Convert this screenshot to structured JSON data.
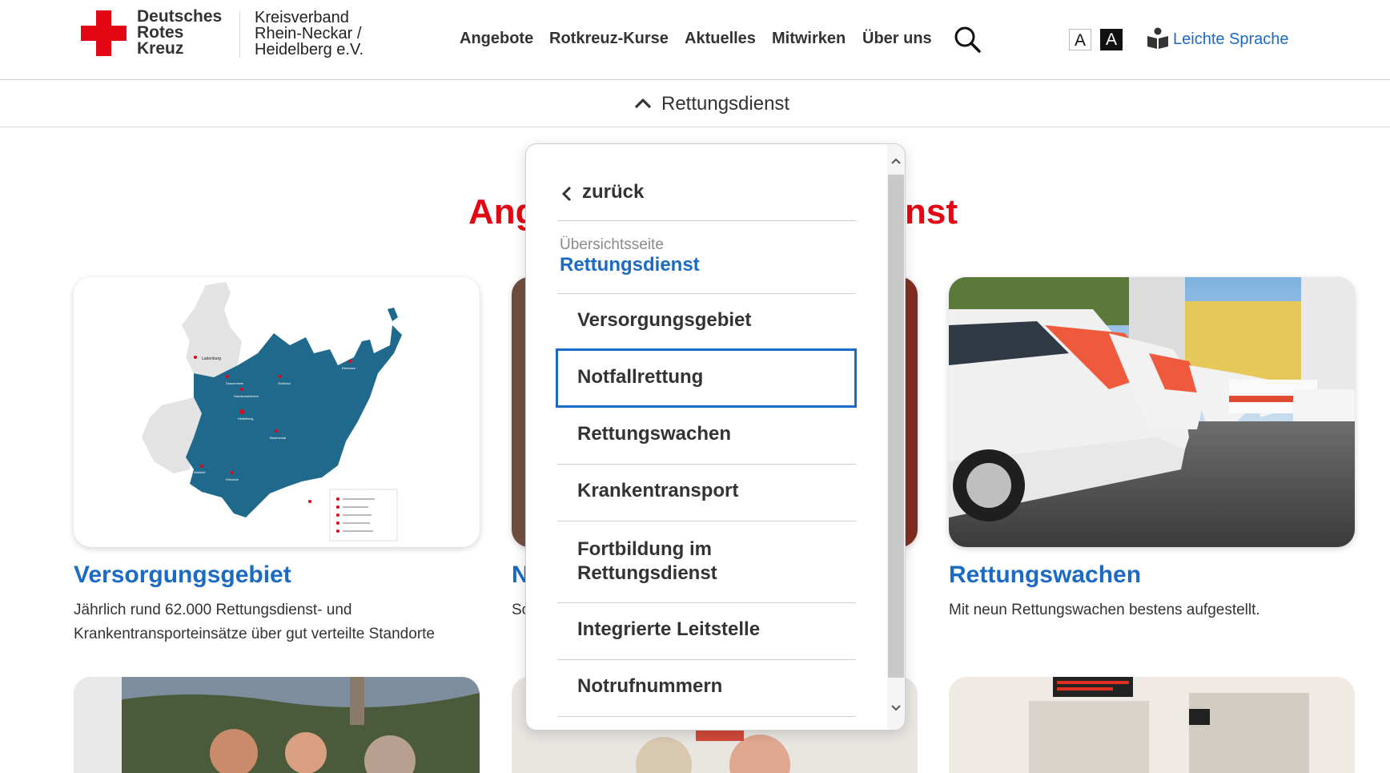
{
  "header": {
    "brand_lines": [
      "Deutsches",
      "Rotes",
      "Kreuz"
    ],
    "verband_lines": [
      "Kreisverband",
      "Rhein-Neckar /",
      "Heidelberg e.V."
    ],
    "nav": [
      "Angebote",
      "Rotkreuz-Kurse",
      "Aktuelles",
      "Mitwirken",
      "Über uns"
    ],
    "contrast_normal": "A",
    "contrast_high": "A",
    "leichte_sprache": "Leichte Sprache"
  },
  "subbar": {
    "label": "Rettungsdienst"
  },
  "page": {
    "heading_left": "Ang",
    "heading_right": "nst"
  },
  "cards": [
    {
      "title": "Versorgungsgebiet",
      "text_lines": [
        "Jährlich rund 62.000 Rettungsdienst- und",
        "Krankentransporteinsätze über gut verteilte Standorte"
      ]
    },
    {
      "title": "N",
      "text_lines": [
        "Sc"
      ]
    },
    {
      "title": "Rettungswachen",
      "text_lines": [
        "Mit neun Rettungswachen bestens aufgestellt."
      ]
    }
  ],
  "dropdown": {
    "back": "zurück",
    "overview_caption": "Übersichtsseite",
    "overview_link": "Rettungsdienst",
    "items": [
      {
        "label_lines": [
          "Versorgungsgebiet"
        ]
      },
      {
        "label_lines": [
          "Notfallrettung"
        ]
      },
      {
        "label_lines": [
          "Rettungswachen"
        ]
      },
      {
        "label_lines": [
          "Krankentransport"
        ]
      },
      {
        "label_lines": [
          "Fortbildung im",
          "Rettungsdienst"
        ]
      },
      {
        "label_lines": [
          "Integrierte Leitstelle"
        ]
      },
      {
        "label_lines": [
          "Notrufnummern"
        ]
      }
    ]
  },
  "colors": {
    "accent_red": "#e30613",
    "link_blue": "#1b6ac3",
    "map_blue": "#1f6a8c"
  }
}
